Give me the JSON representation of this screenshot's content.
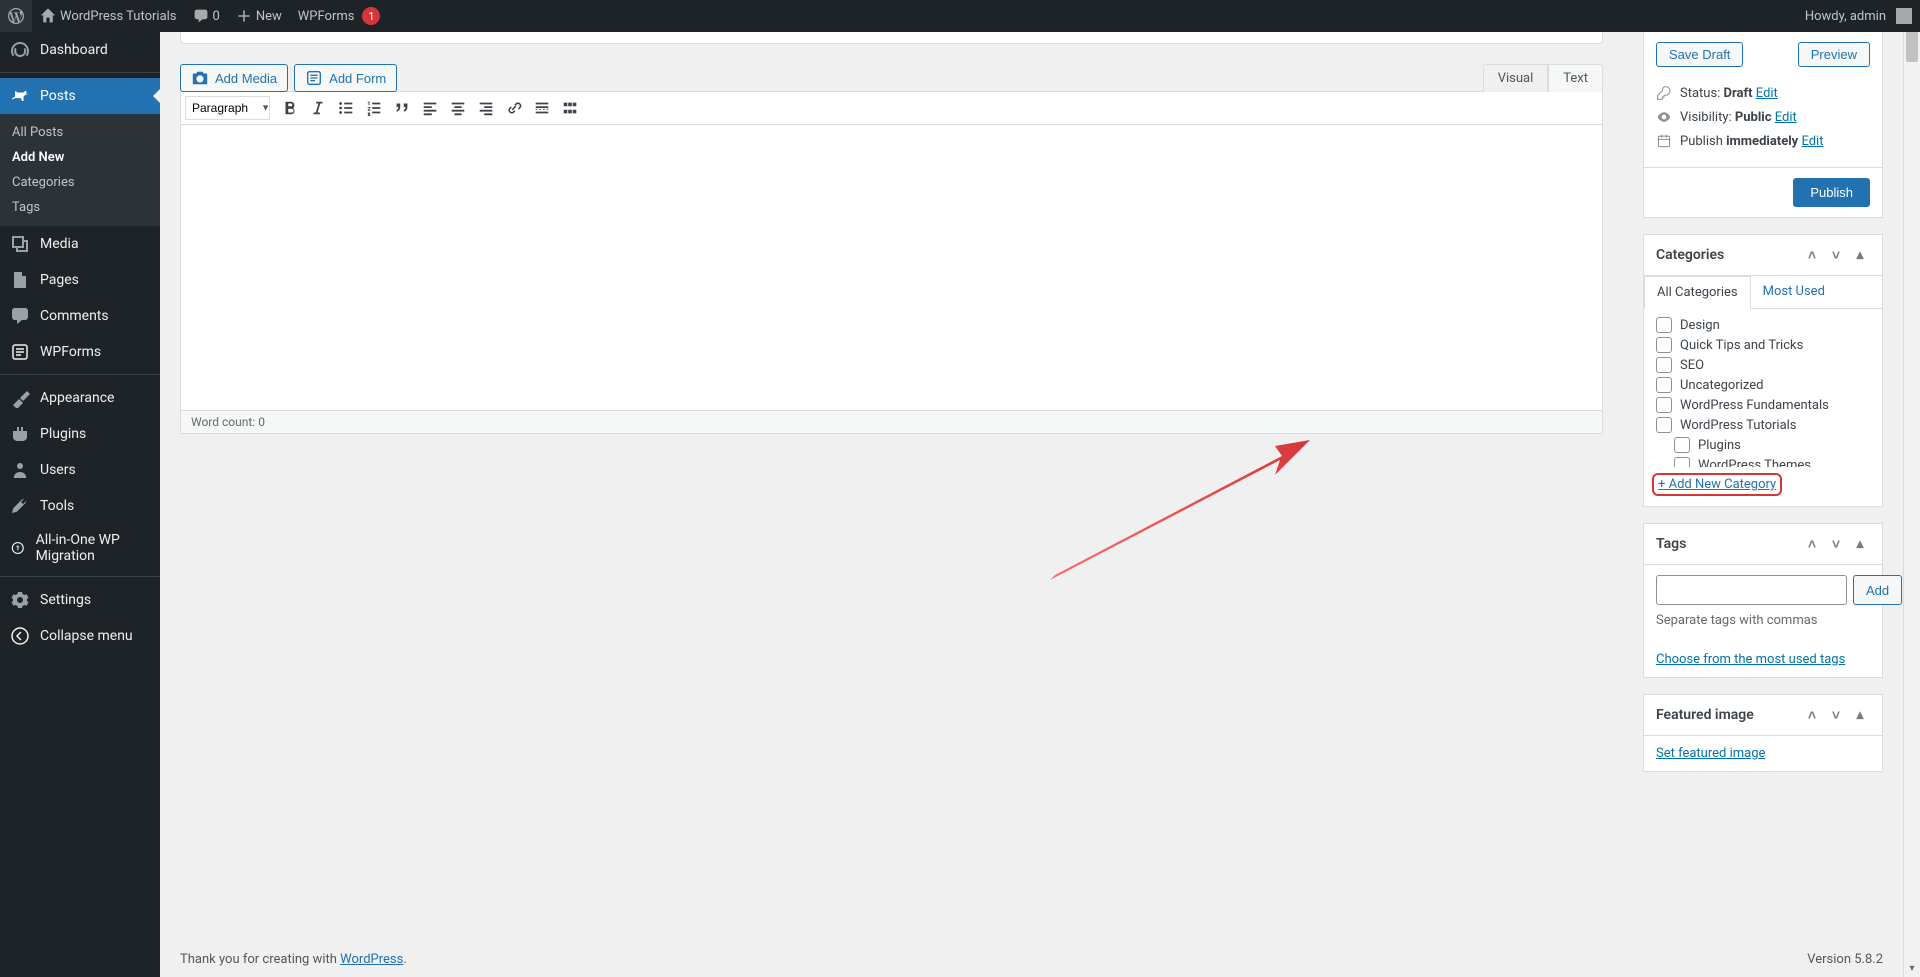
{
  "adminbar": {
    "site_name": "WordPress Tutorials",
    "comments_count": "0",
    "new_label": "New",
    "wpforms_label": "WPForms",
    "wpforms_badge": "1",
    "howdy": "Howdy, admin"
  },
  "sidebar": {
    "dashboard": "Dashboard",
    "posts": "Posts",
    "posts_sub": {
      "all": "All Posts",
      "add": "Add New",
      "cat": "Categories",
      "tag": "Tags"
    },
    "media": "Media",
    "pages": "Pages",
    "comments": "Comments",
    "wpforms": "WPForms",
    "appearance": "Appearance",
    "plugins": "Plugins",
    "users": "Users",
    "tools": "Tools",
    "migration": "All-in-One WP Migration",
    "settings": "Settings",
    "collapse": "Collapse menu"
  },
  "editor": {
    "add_media": "Add Media",
    "add_form": "Add Form",
    "tab_visual": "Visual",
    "tab_text": "Text",
    "format": "Paragraph",
    "word_count_label": "Word count: ",
    "word_count": "0"
  },
  "publish": {
    "save_draft": "Save Draft",
    "preview": "Preview",
    "status_label": "Status: ",
    "status_value": "Draft",
    "visibility_label": "Visibility: ",
    "visibility_value": "Public",
    "schedule_label": "Publish ",
    "schedule_value": "immediately",
    "edit": "Edit",
    "publish": "Publish"
  },
  "categories_box": {
    "title": "Categories",
    "tab_all": "All Categories",
    "tab_most": "Most Used",
    "items": [
      {
        "label": "Design",
        "indent": false
      },
      {
        "label": "Quick Tips and Tricks",
        "indent": false
      },
      {
        "label": "SEO",
        "indent": false
      },
      {
        "label": "Uncategorized",
        "indent": false
      },
      {
        "label": "WordPress Fundamentals",
        "indent": false
      },
      {
        "label": "WordPress Tutorials",
        "indent": false
      },
      {
        "label": "Plugins",
        "indent": true
      },
      {
        "label": "WordPress Themes",
        "indent": true
      }
    ],
    "add_new": "+ Add New Category"
  },
  "tags_box": {
    "title": "Tags",
    "add": "Add",
    "hint": "Separate tags with commas",
    "choose": "Choose from the most used tags"
  },
  "featured_box": {
    "title": "Featured image",
    "set": "Set featured image"
  },
  "footer": {
    "thank": "Thank you for creating with ",
    "wp": "WordPress",
    "version": "Version 5.8.2"
  }
}
